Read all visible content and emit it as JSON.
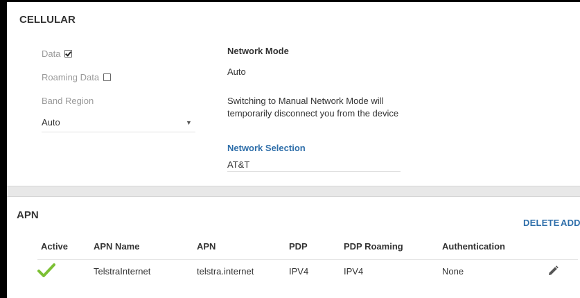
{
  "cellular": {
    "title": "CELLULAR",
    "data_label": "Data",
    "data_checked": true,
    "roaming_label": "Roaming Data",
    "roaming_checked": false,
    "band_region_label": "Band Region",
    "band_region_value": "Auto",
    "network_mode_label": "Network Mode",
    "network_mode_value": "Auto",
    "warning_text": "Switching to Manual Network Mode will temporarily disconnect you from the device",
    "network_selection_label": "Network Selection",
    "network_selection_value": "AT&T"
  },
  "apn": {
    "title": "APN",
    "delete_label": "DELETE",
    "add_label": "ADD",
    "columns": [
      "Active",
      "APN Name",
      "APN",
      "PDP",
      "PDP Roaming",
      "Authentication"
    ],
    "rows": [
      {
        "active": true,
        "name": "TelstraInternet",
        "apn": "telstra.internet",
        "pdp": "IPV4",
        "pdp_roaming": "IPV4",
        "authentication": "None"
      }
    ]
  },
  "colors": {
    "accent": "#2f6faa",
    "active_check": "#7cc034"
  }
}
